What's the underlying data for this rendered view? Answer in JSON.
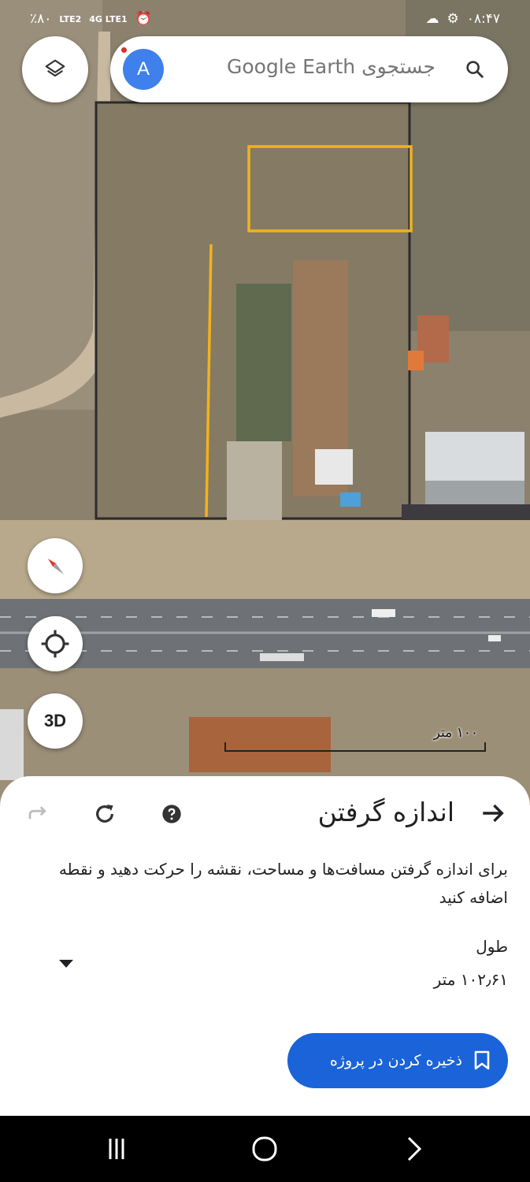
{
  "status_bar": {
    "battery": "٪۸۰",
    "network_1": "LTE2",
    "network_2": "4G LTE1",
    "time": "۰۸:۴۷"
  },
  "search": {
    "placeholder": "جستجوی Google Earth",
    "avatar_letter": "A"
  },
  "map_controls": {
    "three_d_label": "3D",
    "scale_label": "۱۰۰ متر"
  },
  "measure_sheet": {
    "title": "اندازه گرفتن",
    "instruction": "برای اندازه گرفتن مسافت‌ها و مساحت، نقشه را حرکت دهید و نقطه اضافه کنید",
    "metric_label": "طول",
    "metric_value": "۱۰۲٫۶۱ متر",
    "save_button": "ذخیره کردن در پروژه"
  },
  "colors": {
    "accent": "#1a63d8",
    "measure_line": "#f2b21c",
    "avatar": "#3f80ec"
  }
}
